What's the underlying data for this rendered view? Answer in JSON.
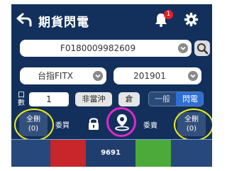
{
  "header": {
    "title": "期貨閃電",
    "notification_count": "1"
  },
  "contract": {
    "value": "F0180009982609"
  },
  "product": {
    "value": "台指FITX"
  },
  "month": {
    "value": "201901"
  },
  "order": {
    "qty_label": "口數",
    "qty_value": "1",
    "non_daytrade_label": "非當沖",
    "position_label": "倉",
    "mode_general": "一般",
    "mode_flash": "閃電",
    "mode_selected": "閃電"
  },
  "actions": {
    "clear_all_left": "全刪",
    "clear_all_left_count": "(0)",
    "entrust_buy": "委買",
    "entrust_sell": "委賣",
    "clear_all_right": "全刪",
    "clear_all_right_count": "(0)"
  },
  "ladder": {
    "price": "9691",
    "colors": {
      "bid": "#c7262b",
      "ask": "#4caa3a",
      "panel": "#13305c"
    }
  },
  "icons": [
    "back-arrow-icon",
    "bell-icon",
    "gear-icon",
    "chevron-down-icon",
    "search-icon",
    "lock-icon",
    "location-icon"
  ]
}
